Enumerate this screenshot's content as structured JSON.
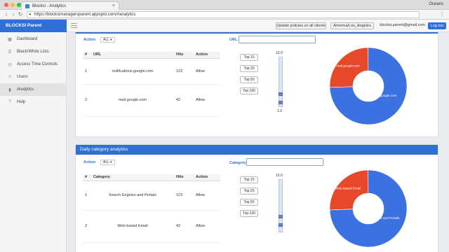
{
  "browser": {
    "tab_title": "Blocksi - Analytics",
    "url": "https://blocksimanagersparent.appspot.com/#analytics",
    "profile": "Oceans"
  },
  "app": {
    "brand": "BLOCKSI Parent Dashboard",
    "update_button": "Update policies on all clients",
    "timezone": "America/Los_Angeles",
    "email": "blocksi.parent@gmail.com",
    "logout": "Log out"
  },
  "sidebar": {
    "items": [
      {
        "label": "Dashboard",
        "icon": "dashboard-icon"
      },
      {
        "label": "Black/White Lists",
        "icon": "list-icon"
      },
      {
        "label": "Access Time Controls",
        "icon": "clock-icon"
      },
      {
        "label": "Users",
        "icon": "users-icon"
      },
      {
        "label": "Analytics",
        "icon": "chart-icon"
      },
      {
        "label": "Help",
        "icon": "help-icon"
      }
    ]
  },
  "url_panel": {
    "action_label": "Action",
    "action_value": "ALL",
    "url_label": "URL",
    "url_value": "",
    "columns": [
      "#",
      "URL",
      "Hits",
      "Action"
    ],
    "rows": [
      [
        "1",
        "notifications.google.com",
        "123",
        "Allow"
      ],
      [
        "2",
        "mail.google.com",
        "42",
        "Allow"
      ]
    ],
    "top_buttons": [
      "Top 10",
      "Top 20",
      "Top 50",
      "Top 100"
    ],
    "slider_max": "10.0",
    "slider_min": "1.0",
    "donut_labels": [
      "mail.google.com",
      "notifications.google.com"
    ]
  },
  "category_panel": {
    "title": "Daily category analytics",
    "action_label": "Action",
    "action_value": "ALL",
    "category_label": "Category",
    "category_value": "",
    "columns": [
      "#",
      "Category",
      "Hits",
      "Action"
    ],
    "rows": [
      [
        "1",
        "Search Engines and Portals",
        "123",
        "Allow"
      ],
      [
        "2",
        "Web-based Email",
        "42",
        "Allow"
      ]
    ],
    "top_buttons": [
      "Top 10",
      "Top 20",
      "Top 50",
      "Top 100"
    ],
    "slider_max": "10.0",
    "slider_min": "1.0",
    "donut_labels": [
      "Web-based Email",
      "Search Engines and Portals"
    ]
  },
  "chart_data": [
    {
      "type": "pie",
      "categories": [
        "notifications.google.com",
        "mail.google.com"
      ],
      "values": [
        123,
        42
      ],
      "colors": [
        "#3b71e0",
        "#e8482a"
      ]
    },
    {
      "type": "pie",
      "categories": [
        "Search Engines and Portals",
        "Web-based Email"
      ],
      "values": [
        123,
        42
      ],
      "colors": [
        "#3b71e0",
        "#e8482a"
      ]
    }
  ]
}
